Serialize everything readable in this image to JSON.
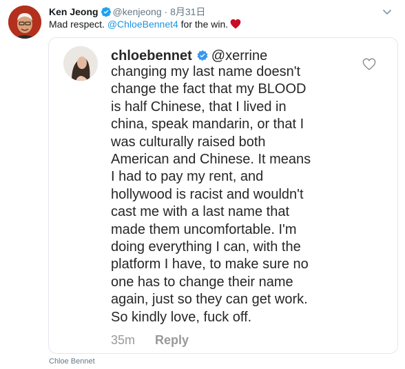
{
  "tweet": {
    "author_name": "Ken Jeong",
    "author_handle": "@kenjeong",
    "separator": "·",
    "date": "8月31日",
    "text_prefix": "Mad respect. ",
    "mention": "@ChloeBennet4",
    "text_suffix": " for the win.",
    "emoji": "red-heart",
    "icons": {
      "verified": "verified-badge-icon",
      "menu": "chevron-down-icon"
    }
  },
  "embedded_post": {
    "username": "chloebennet",
    "reply_to": "@xerrine",
    "lines": [
      "changing my last name doesn't",
      "change the fact that my BLOOD",
      "is half Chinese, that I lived in",
      "china, speak mandarin, or that I",
      "was culturally raised both",
      "American and Chinese. It means",
      "I had to pay my rent, and",
      "hollywood is racist and wouldn't",
      "cast me with a last name that",
      "made them uncomfortable. I'm",
      "doing everything I can, with the",
      "platform I have, to make sure no",
      "one has to change their name",
      "again, just so they can get work.",
      "So kindly love, fuck off."
    ],
    "age": "35m",
    "reply_label": "Reply",
    "icons": {
      "verified": "verified-badge-icon",
      "like": "heart-outline-icon"
    }
  },
  "media_caption": "Chloe Bennet",
  "colors": {
    "link_blue": "#1b95e0",
    "text_dark": "#14171a",
    "text_muted": "#657786",
    "ig_text": "#262626",
    "ig_muted": "#999999",
    "verified_blue": "#3897f0",
    "heart_red": "#c90d25"
  }
}
